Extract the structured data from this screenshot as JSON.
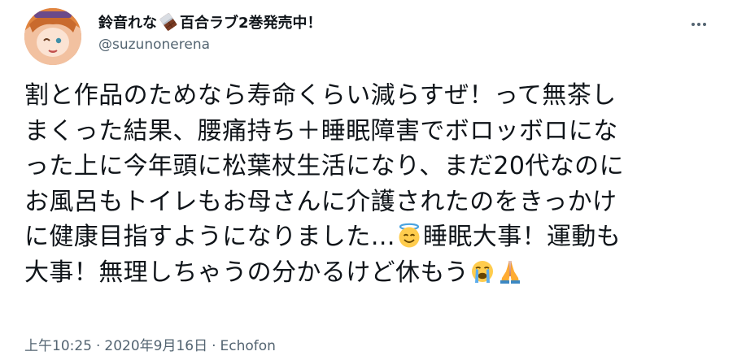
{
  "author": {
    "display_name_prefix": "鈴音れな",
    "display_name_suffix": "百合ラブ2巻発売中！",
    "name_icon": "chocolate-bar-icon",
    "handle": "@suzunonerena",
    "avatar": "avatar-image"
  },
  "menu": {
    "icon": "more-horizontal-icon"
  },
  "tweet": {
    "lines": [
      "割と作品のためなら寿命くらい減らすぜ！って無茶し",
      "まくった結果、腰痛持ち＋睡眠障害でボロッボロにな",
      "った上に今年頭に松葉杖生活になり、まだ20代なのに",
      "お風呂もトイレもお母さんに介護されたのをきっかけ",
      "に健康目指すようになりました…",
      "睡眠大事！運動も",
      "大事！無理しちゃうの分かるけど休もう"
    ],
    "emojis": {
      "halo": "smiling-face-with-halo-icon",
      "crying": "loudly-crying-face-icon",
      "pray": "folded-hands-icon"
    }
  },
  "meta": {
    "time": "上午10:25",
    "separator": "·",
    "date": "2020年9月16日",
    "source": "Echofon"
  },
  "colors": {
    "text": "#0f1419",
    "secondary": "#536471",
    "background": "#ffffff"
  }
}
